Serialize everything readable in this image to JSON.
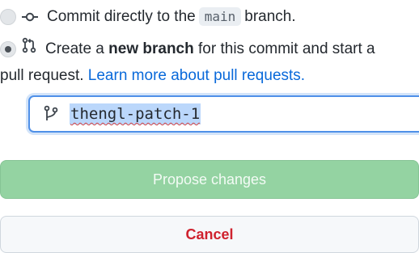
{
  "commit_options": {
    "direct": {
      "text_before": "Commit directly to the",
      "branch_name": "main",
      "text_after": "branch.",
      "icon": "git-commit-icon",
      "selected": false
    },
    "new_branch": {
      "text_before": "Create a",
      "text_bold": "new branch",
      "text_after": "for this commit and start a",
      "text_line2": "pull request.",
      "link_text": "Learn more about pull requests.",
      "icon": "git-pull-request-icon",
      "selected": true
    }
  },
  "branch_input": {
    "icon": "git-branch-icon",
    "value": "thengl-patch-1"
  },
  "buttons": {
    "propose_label": "Propose changes",
    "cancel_label": "Cancel"
  },
  "colors": {
    "link": "#0969da",
    "propose_bg": "#94d3a2",
    "cancel_text": "#cf222e",
    "focus_ring": "#4f90e8"
  }
}
